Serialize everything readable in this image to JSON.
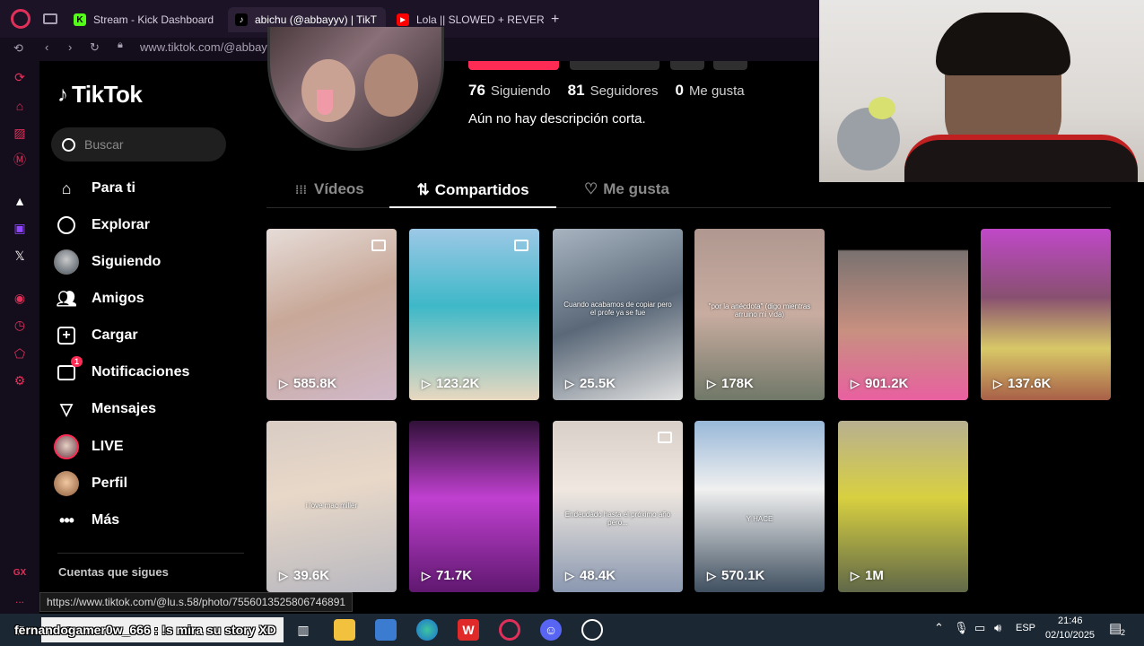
{
  "browser": {
    "tabs": [
      {
        "title": "Stream - Kick Dashboard",
        "favicon": "kick-icon"
      },
      {
        "title": "abichu (@abbayyv) | TikT",
        "favicon": "tiktok-icon"
      },
      {
        "title": "Lola || SLOWED + REVERE",
        "favicon": "youtube-icon"
      }
    ],
    "new_tab_label": "+",
    "url": "www.tiktok.com/@abbayyv",
    "status_url": "https://www.tiktok.com/@lu.s.58/photo/7556013525806746891"
  },
  "opera_sidebar": {
    "gx_label": "GX",
    "more_label": "..."
  },
  "tiktok": {
    "logo_text": "TikTok",
    "search_placeholder": "Buscar",
    "nav": [
      {
        "label": "Para ti",
        "icon": "home-icon"
      },
      {
        "label": "Explorar",
        "icon": "compass-icon"
      },
      {
        "label": "Siguiendo",
        "icon": "following-avatar"
      },
      {
        "label": "Amigos",
        "icon": "friends-icon"
      },
      {
        "label": "Cargar",
        "icon": "upload-icon"
      },
      {
        "label": "Notificaciones",
        "icon": "inbox-icon",
        "badge": "1"
      },
      {
        "label": "Mensajes",
        "icon": "send-icon"
      },
      {
        "label": "LIVE",
        "icon": "live-avatar"
      },
      {
        "label": "Perfil",
        "icon": "profile-avatar"
      },
      {
        "label": "Más",
        "icon": "more-icon"
      }
    ],
    "following_header": "Cuentas que sigues"
  },
  "profile": {
    "following_count": "76",
    "following_label": "Siguiendo",
    "followers_count": "81",
    "followers_label": "Seguidores",
    "likes_count": "0",
    "likes_label": "Me gusta",
    "bio": "Aún no hay descripción corta.",
    "tabs": [
      "Vídeos",
      "Compartidos",
      "Me gusta"
    ],
    "active_tab": "Compartidos"
  },
  "grid": [
    {
      "views": "585.8K",
      "photo": true
    },
    {
      "views": "123.2K",
      "photo": true
    },
    {
      "views": "25.5K",
      "photo": false,
      "caption": "Cuando acabamos de copiar pero el profe ya se fue"
    },
    {
      "views": "178K",
      "photo": false,
      "caption": "\"por la anécdota\" (digo mientras arruino mi vida)"
    },
    {
      "views": "901.2K",
      "photo": false
    },
    {
      "views": "137.6K",
      "photo": false
    },
    {
      "views": "39.6K",
      "photo": false,
      "caption": "i love mac miller"
    },
    {
      "views": "71.7K",
      "photo": false
    },
    {
      "views": "48.4K",
      "photo": true,
      "caption": "Endeudado hasta el próximo año pero..."
    },
    {
      "views": "570.1K",
      "photo": false,
      "caption": "Y HACE"
    },
    {
      "views": "1M",
      "photo": false
    }
  ],
  "taskbar": {
    "search_placeholder": "Buscar",
    "stream_overlay": "fernandogamer0w_666 : !s mira su story XD",
    "language": "ESP",
    "time": "21:46",
    "date": "02/10/2025",
    "notification_count": "2"
  },
  "colors": {
    "accent": "#fe2c55",
    "opera_red": "#e0305a",
    "bg": "#000000"
  }
}
